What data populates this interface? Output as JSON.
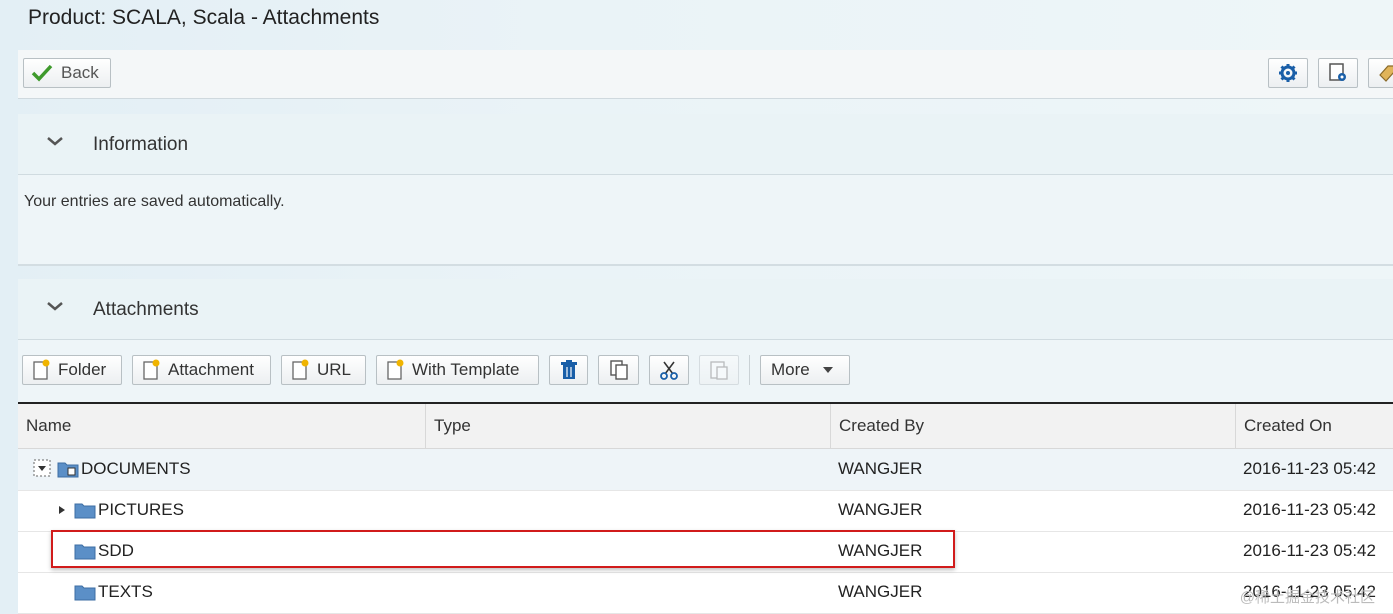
{
  "title": "Product: SCALA, Scala - Attachments",
  "toolbar": {
    "back_label": "Back"
  },
  "info_panel": {
    "title": "Information",
    "message": "Your entries are saved automatically."
  },
  "attachments_panel": {
    "title": "Attachments",
    "buttons": {
      "folder": "Folder",
      "attachment": "Attachment",
      "url": "URL",
      "with_template": "With Template",
      "more": "More"
    }
  },
  "table": {
    "columns": [
      "Name",
      "Type",
      "Created By",
      "Created On"
    ],
    "rows": [
      {
        "name": "DOCUMENTS",
        "type": "",
        "created_by": "WANGJER",
        "created_on": "2016-11-23 05:42"
      },
      {
        "name": "PICTURES",
        "type": "",
        "created_by": "WANGJER",
        "created_on": "2016-11-23 05:42"
      },
      {
        "name": "SDD",
        "type": "",
        "created_by": "WANGJER",
        "created_on": "2016-11-23 05:42"
      },
      {
        "name": "TEXTS",
        "type": "",
        "created_by": "WANGJER",
        "created_on": "2016-11-23 05:42"
      }
    ]
  },
  "watermark": "@稀土掘金技术社区",
  "colors": {
    "accent": "#1a5fa8",
    "highlight": "#d11b1b",
    "folder": "#5b8fc7"
  }
}
